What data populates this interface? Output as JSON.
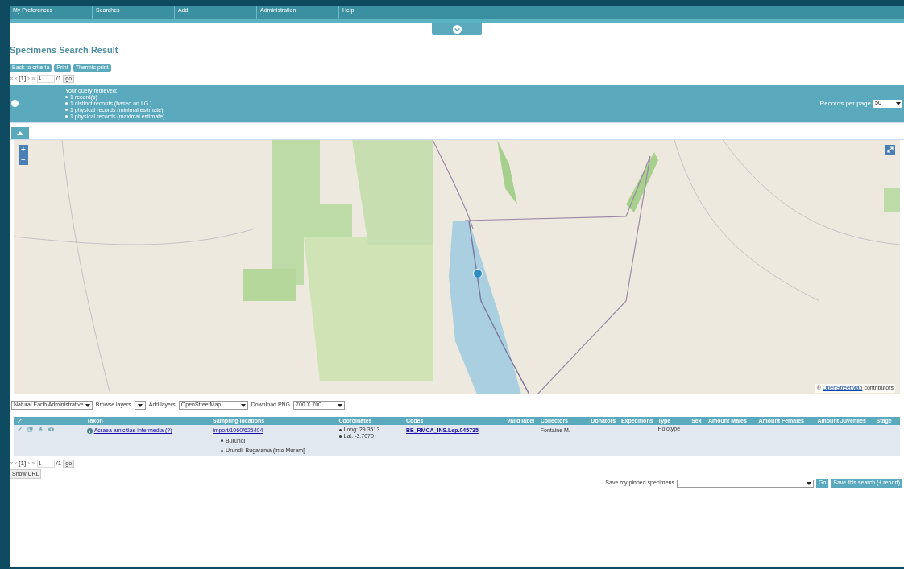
{
  "nav": [
    "My Preferences",
    "Searches",
    "Add",
    "Administration",
    "Help"
  ],
  "title": "Specimens Search Result",
  "buttons": [
    "Back to criteria",
    "Print",
    "Thermic print"
  ],
  "pager_top": {
    "first": "« ‹",
    "current": "[1]",
    "next": "› »",
    "page": "1",
    "total": "/1",
    "go": "go"
  },
  "info": {
    "heading": "Your query retrieved:",
    "lines": [
      "1 record(s)",
      "1 distinct records (based on I.G.)",
      "1 physical records (minimal estimate)",
      "1 physical records (maximal estimate)"
    ],
    "records_label": "Records per page",
    "records_value": "50"
  },
  "map": {
    "zoom_in": "+",
    "zoom_out": "−",
    "attribution_prefix": "©",
    "attribution_link": "OpenStreetMap",
    "attribution_suffix": "contributors"
  },
  "layers": {
    "base": "Natural Earth Administrative",
    "browse": "Browse layers",
    "add": "Add layers",
    "source": "OpenStreetMap",
    "download": "Download PNG",
    "size": "700 X 700"
  },
  "table": {
    "columns": [
      "Taxon",
      "Sampling locations",
      "Coordinates",
      "Codes",
      "Valid label",
      "Collectors",
      "Donators",
      "Expeditions",
      "Type",
      "Sex",
      "Amount Males",
      "Amount Females",
      "Amount Juveniles",
      "Stage"
    ],
    "rows": [
      {
        "taxon": "Acraea amicitiae intermedia (?)",
        "sampling": "import/1060/625404",
        "locations": [
          "Burundi",
          "Urundi: Bugarama (into Muram["
        ],
        "coordinates": [
          "Long: 29.3513",
          "Lat: -3.7070"
        ],
        "code": "BE_RMCA_INS.Lep.045735",
        "collectors": "Fontaine M.",
        "type": "Holotype"
      }
    ]
  },
  "pager_bottom": {
    "first": "« ‹",
    "current": "[1]",
    "next": "› »",
    "page": "1",
    "total": "/1",
    "go": "go"
  },
  "show_url": "Show URL",
  "save": {
    "label": "Save my pinned specimens",
    "go": "Go",
    "save_search": "Save this search (+ report)"
  }
}
